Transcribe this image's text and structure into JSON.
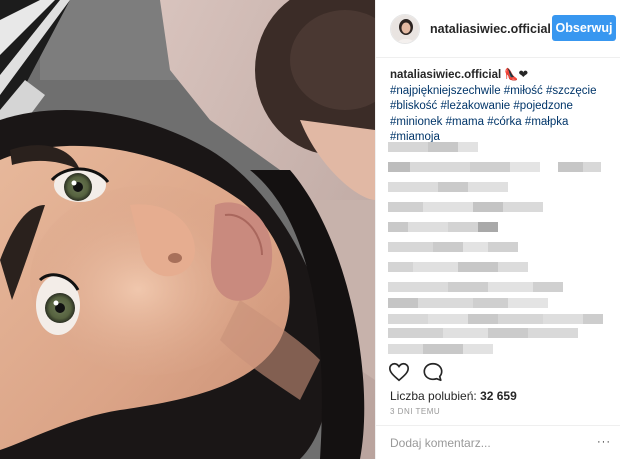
{
  "post": {
    "author": {
      "username": "nataliasiwiec.official",
      "verified_icon": "verified-badge-icon"
    },
    "follow_label": "Obserwuj",
    "caption": {
      "author": "nataliasiwiec.official",
      "emoji": "👠❤",
      "hashtags": [
        "#najpiękniejszechwile",
        "#miłość",
        "#szczęcie",
        "#bliskość",
        "#leżakowanie",
        "#pojedzone",
        "#minionek",
        "#mama",
        "#córka",
        "#małpka",
        "#miamoja"
      ]
    },
    "likes_label": "Liczba polubień:",
    "likes_count": "32 659",
    "time_ago": "3 DNI TEMU",
    "comment_placeholder": "Dodaj komentarz...",
    "more_label": "···"
  },
  "colors": {
    "accent": "#3897f0",
    "hashtag": "#003569",
    "muted": "#999999",
    "text": "#262626"
  },
  "icons": {
    "like": "heart-icon",
    "comment": "comment-bubble-icon",
    "options": "more-options-icon"
  }
}
